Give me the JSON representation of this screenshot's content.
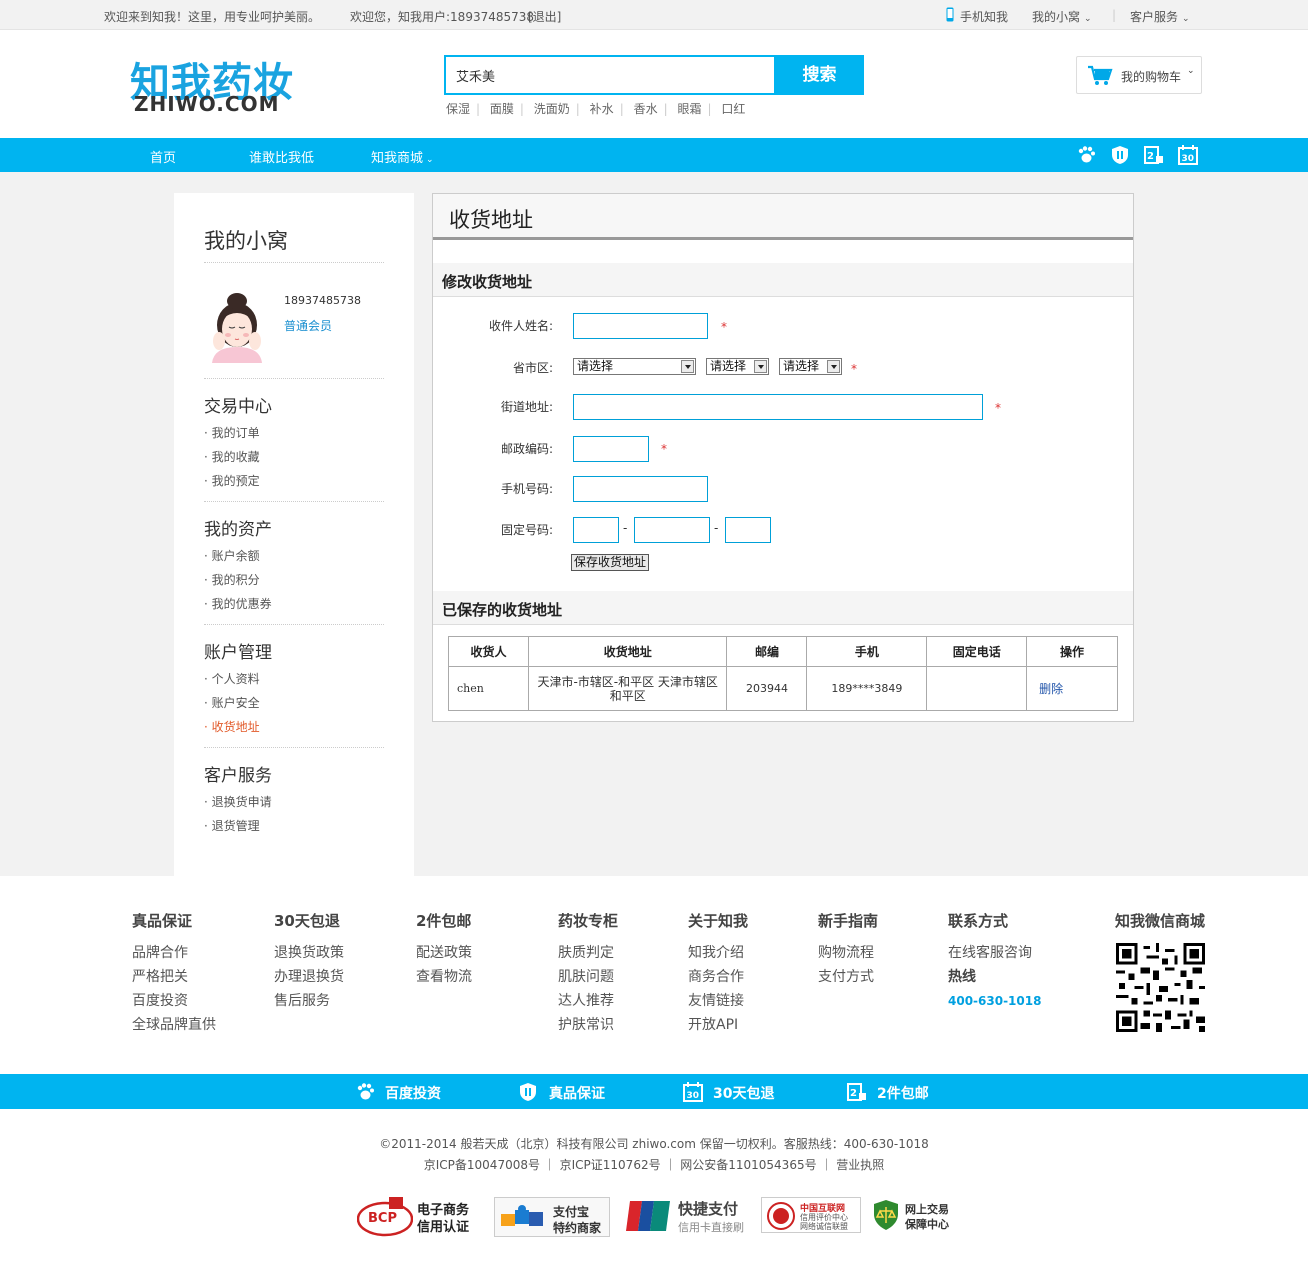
{
  "topbar": {
    "welcome": "欢迎来到知我！这里，用专业呵护美丽。",
    "user_greeting": "欢迎您，知我用户:18937485738",
    "logout": "[退出]",
    "mobile": "手机知我",
    "my_nest": "我的小窝",
    "customer_service": "客户服务"
  },
  "header": {
    "logo_cn": "知我药妆",
    "logo_en": "ZHIWO.COM",
    "search_value": "艾禾美",
    "search_button": "搜索",
    "hot_keywords": [
      "保湿",
      "面膜",
      "洗面奶",
      "补水",
      "香水",
      "眼霜",
      "口红"
    ],
    "cart": "我的购物车"
  },
  "nav": {
    "items": [
      "首页",
      "谁敢比我低",
      "知我商城"
    ]
  },
  "sidebar": {
    "title": "我的小窝",
    "phone": "18937485738",
    "member_level": "普通会员",
    "sections": [
      {
        "title": "交易中心",
        "links": [
          "我的订单",
          "我的收藏",
          "我的预定"
        ]
      },
      {
        "title": "我的资产",
        "links": [
          "账户余额",
          "我的积分",
          "我的优惠券"
        ]
      },
      {
        "title": "账户管理",
        "links": [
          "个人资料",
          "账户安全",
          "收货地址"
        ]
      },
      {
        "title": "客户服务",
        "links": [
          "退换货申请",
          "退货管理"
        ]
      }
    ]
  },
  "main": {
    "title": "收货地址",
    "edit_section": "修改收货地址",
    "form": {
      "name_label": "收件人姓名:",
      "region_label": "省市区:",
      "region_selects": [
        "请选择",
        "请选择",
        "请选择"
      ],
      "street_label": "街道地址:",
      "zip_label": "邮政编码:",
      "mobile_label": "手机号码:",
      "phone_label": "固定号码:",
      "required_mark": "*",
      "dash": "-",
      "save_button": "保存收货地址"
    },
    "saved_section": "已保存的收货地址",
    "table": {
      "headers": [
        "收货人",
        "收货地址",
        "邮编",
        "手机",
        "固定电话",
        "操作"
      ],
      "rows": [
        {
          "name": "chen",
          "address": "天津市-市辖区-和平区 天津市辖区和平区",
          "zip": "203944",
          "mobile": "189****3849",
          "phone": "",
          "action": "删除"
        }
      ]
    }
  },
  "footer": {
    "columns": [
      {
        "title": "真品保证",
        "links": [
          "品牌合作",
          "严格把关",
          "百度投资",
          "全球品牌直供"
        ]
      },
      {
        "title": "30天包退",
        "links": [
          "退换货政策",
          "办理退换货",
          "售后服务"
        ]
      },
      {
        "title": "2件包邮",
        "links": [
          "配送政策",
          "查看物流"
        ]
      },
      {
        "title": "药妆专柜",
        "links": [
          "肤质判定",
          "肌肤问题",
          "达人推荐",
          "护肤常识"
        ]
      },
      {
        "title": "关于知我",
        "links": [
          "知我介绍",
          "商务合作",
          "友情链接",
          "开放API"
        ]
      },
      {
        "title": "新手指南",
        "links": [
          "购物流程",
          "支付方式"
        ]
      }
    ],
    "contact": {
      "title": "联系方式",
      "online": "在线客服咨询",
      "hotline_label": "热线",
      "hotline": "400-630-1018"
    },
    "wechat": {
      "title": "知我微信商城"
    },
    "band": [
      "百度投资",
      "真品保证",
      "30天包退",
      "2件包邮"
    ],
    "copyright": "©2011-2014 般若天成（北京）科技有限公司 zhiwo.com 保留一切权利。客服热线：400-630-1018",
    "icp": [
      "京ICP备10047008号",
      "京ICP证110762号",
      "网公安备1101054365号",
      "营业执照"
    ],
    "badges": {
      "bcp_mark": "BCP",
      "bcp_1": "电子商务",
      "bcp_2": "信用认证",
      "alipay_1": "支付宝",
      "alipay_2": "特约商家",
      "unionpay_1": "快捷支付",
      "unionpay_2": "信用卡直接刷",
      "cnnic_1": "中国互联网",
      "cnnic_2": "信用评价中心",
      "cnnic_3": "网络诚信联盟",
      "guarantee_1": "网上交易",
      "guarantee_2": "保障中心"
    }
  },
  "colors": {
    "accent": "#00b4f0",
    "link_active": "#e25a2a",
    "required": "#dd3333"
  }
}
